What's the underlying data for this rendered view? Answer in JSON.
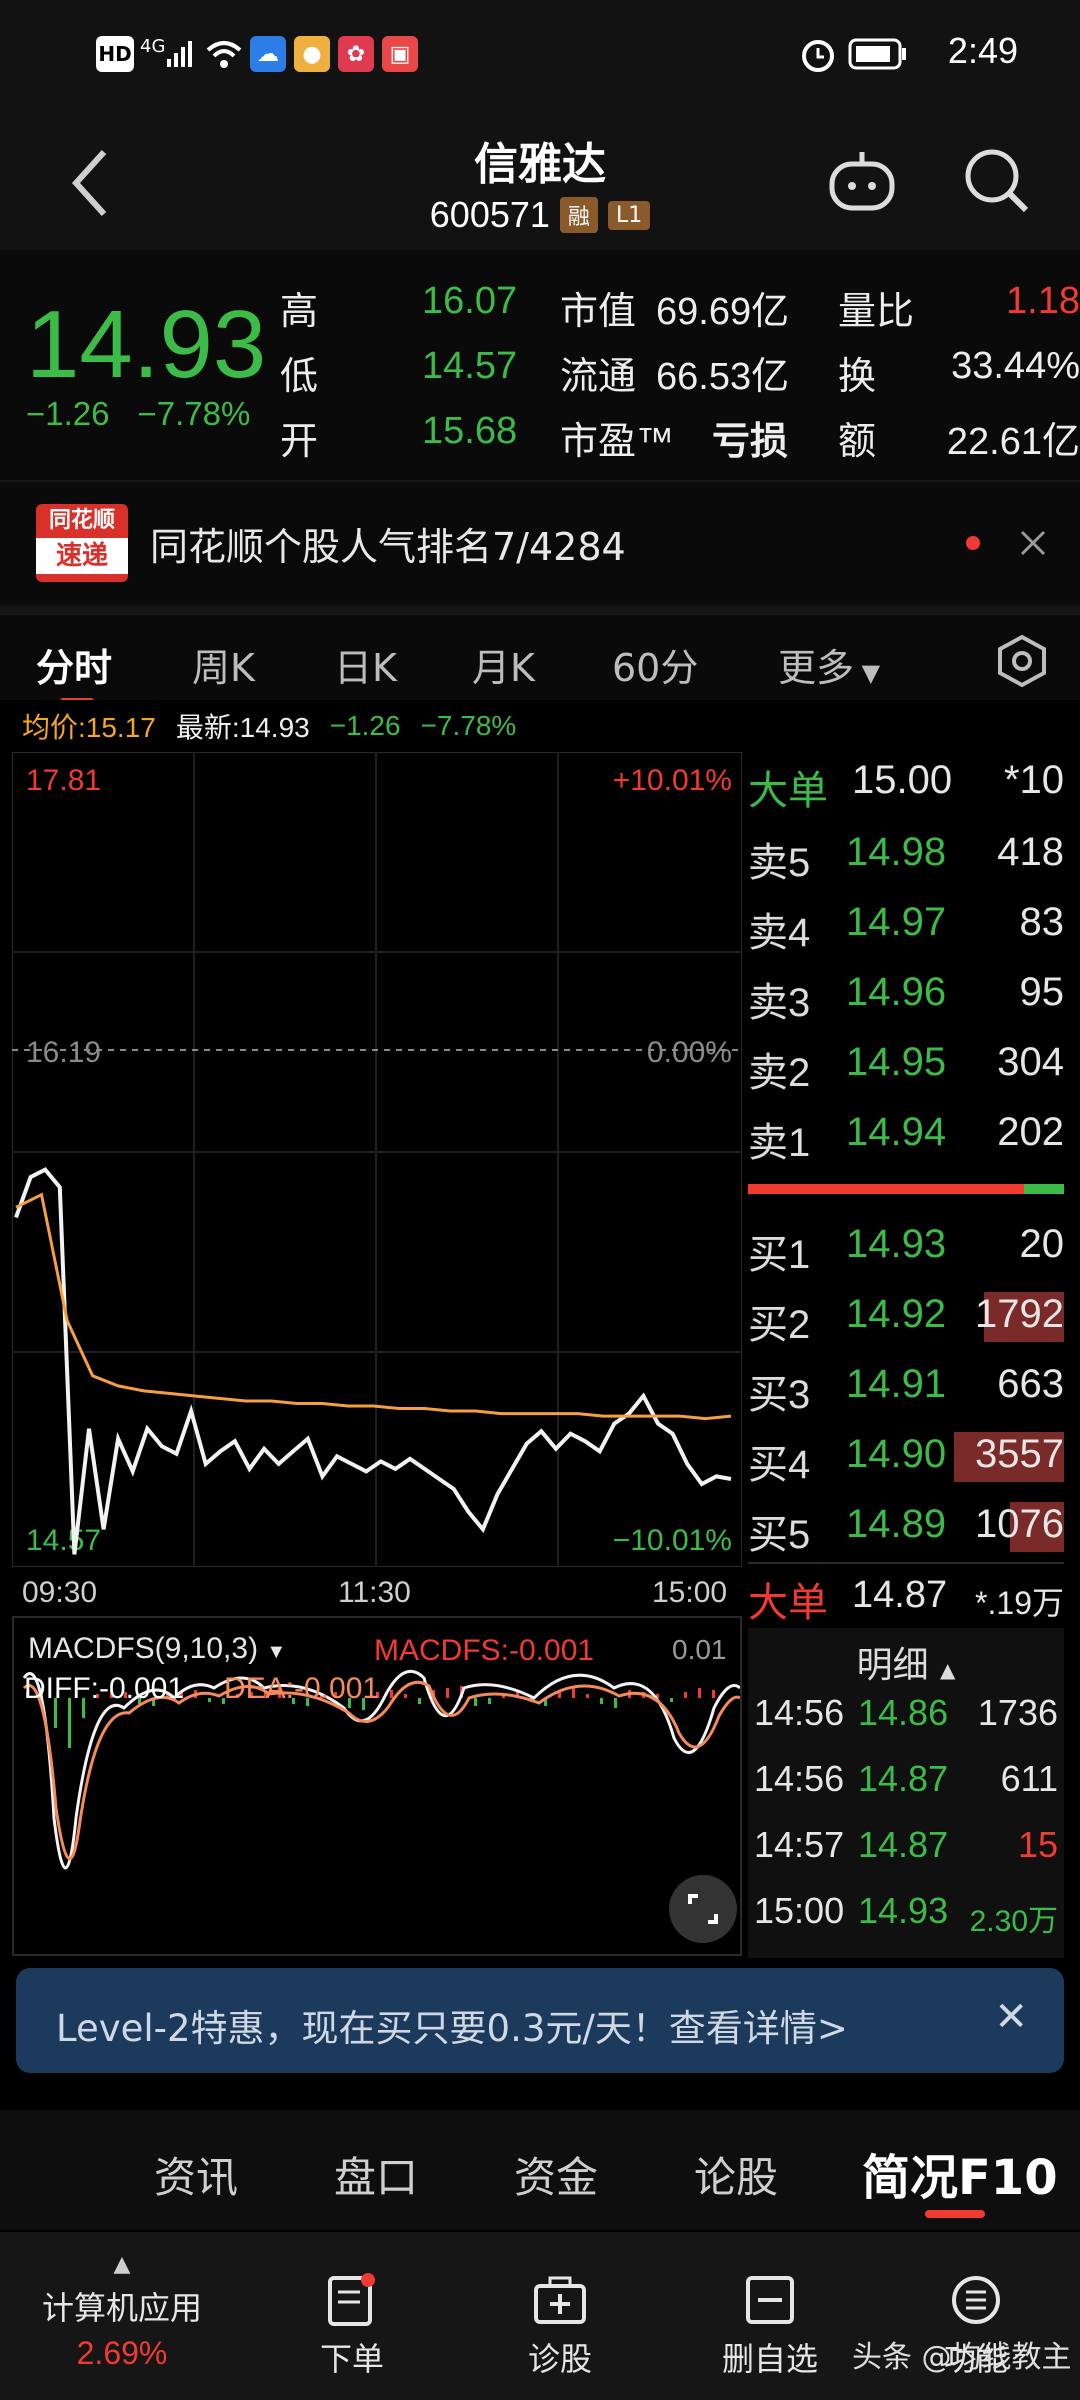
{
  "status_bar": {
    "hd": "HD",
    "net": "4G",
    "time": "2:49",
    "icons": [
      "signal-icon",
      "wifi-icon",
      "cloud-app-icon",
      "app-icon",
      "app-icon",
      "app-icon",
      "alarm-icon",
      "battery-icon"
    ]
  },
  "header": {
    "title": "信雅达",
    "code": "600571",
    "tag_margin": "融",
    "tag_level": "L1"
  },
  "quote": {
    "price": "14.93",
    "change": "−1.26",
    "change_pct": "−7.78%",
    "high_label": "高",
    "high": "16.07",
    "low_label": "低",
    "low": "14.57",
    "open_label": "开",
    "open": "15.68",
    "mcap_label": "市值",
    "mcap": "69.69亿",
    "float_label": "流通",
    "float": "66.53亿",
    "pe_label": "市盈™",
    "pe": "亏损",
    "vr_label": "量比",
    "vr": "1.18",
    "turn_label": "换",
    "turn": "33.44%",
    "amt_label": "额",
    "amt": "22.61亿"
  },
  "news": {
    "logo_top": "同花顺",
    "logo_bottom": "速递",
    "text": "同花顺个股人气排名7/4284"
  },
  "tabs": [
    "分时",
    "周K",
    "日K",
    "月K",
    "60分",
    "更多"
  ],
  "infoline": {
    "avg": "均价:15.17",
    "latest": "最新:14.93",
    "chg": "−1.26",
    "pct": "−7.78%"
  },
  "chart_data": {
    "type": "line",
    "y_max_label": "17.81",
    "y_mid_label": "16.19",
    "y_min_label": "14.57",
    "pct_max_label": "+10.01%",
    "pct_mid_label": "0.00%",
    "pct_min_label": "−10.01%",
    "x_labels": [
      "09:30",
      "11:30",
      "15:00"
    ],
    "ylim": [
      14.57,
      17.81
    ],
    "prev_close": 16.19,
    "series": [
      {
        "name": "price",
        "values": [
          15.96,
          16.12,
          16.15,
          16.08,
          14.62,
          15.12,
          14.72,
          15.08,
          14.95,
          15.12,
          15.05,
          15.02,
          15.19,
          14.98,
          15.03,
          15.07,
          14.96,
          15.04,
          14.98,
          15.03,
          15.08,
          14.93,
          15.01,
          14.98,
          14.95,
          14.99,
          14.96,
          15.0,
          14.96,
          14.92,
          14.88,
          14.79,
          14.72,
          14.86,
          14.96,
          15.06,
          15.11,
          15.04,
          15.1,
          15.07,
          15.03,
          15.14,
          15.18,
          15.25,
          15.14,
          15.1,
          14.98,
          14.9,
          14.93,
          14.92
        ]
      },
      {
        "name": "avg",
        "values": [
          16.0,
          16.05,
          15.55,
          15.33,
          15.29,
          15.27,
          15.26,
          15.25,
          15.24,
          15.23,
          15.23,
          15.22,
          15.22,
          15.21,
          15.21,
          15.2,
          15.2,
          15.19,
          15.19,
          15.18,
          15.18,
          15.18,
          15.18,
          15.17,
          15.17,
          15.17,
          15.17,
          15.16,
          15.17
        ]
      }
    ]
  },
  "macd": {
    "title": "MACDFS(9,10,3)",
    "macd_label": "MACDFS:-0.001",
    "diff_label": "DIFF:-0.001",
    "dea_label": "DEA:-0.001",
    "right_val": "0.01"
  },
  "book": {
    "big_sell": {
      "label": "大单",
      "price": "15.00",
      "vol": "*10"
    },
    "sells": [
      {
        "label": "卖5",
        "price": "14.98",
        "vol": "418"
      },
      {
        "label": "卖4",
        "price": "14.97",
        "vol": "83"
      },
      {
        "label": "卖3",
        "price": "14.96",
        "vol": "95"
      },
      {
        "label": "卖2",
        "price": "14.95",
        "vol": "304"
      },
      {
        "label": "卖1",
        "price": "14.94",
        "vol": "202"
      }
    ],
    "buys": [
      {
        "label": "买1",
        "price": "14.93",
        "vol": "20"
      },
      {
        "label": "买2",
        "price": "14.92",
        "vol": "1792"
      },
      {
        "label": "买3",
        "price": "14.91",
        "vol": "663"
      },
      {
        "label": "买4",
        "price": "14.90",
        "vol": "3557"
      },
      {
        "label": "买5",
        "price": "14.89",
        "vol": "1076"
      }
    ],
    "big_buy": {
      "label": "大单",
      "price": "14.87",
      "vol": "*.19万"
    },
    "detail_title": "明细",
    "ticks": [
      {
        "time": "14:56",
        "price": "14.86",
        "vol": "1736"
      },
      {
        "time": "14:56",
        "price": "14.87",
        "vol": "611"
      },
      {
        "time": "14:57",
        "price": "14.87",
        "vol": "15"
      },
      {
        "time": "15:00",
        "price": "14.93",
        "vol": "2.30万"
      }
    ]
  },
  "promo": {
    "text": "Level-2特惠，现在买只要0.3元/天！查看详情>",
    "close": "✕"
  },
  "lower_tabs": [
    "资讯",
    "盘口",
    "资金",
    "论股",
    "简况F10"
  ],
  "bottom_bar": {
    "sector_name": "计算机应用",
    "sector_pct": "2.69%",
    "order": "下单",
    "diagnose": "诊股",
    "remove_fav": "删自选",
    "more": "功能",
    "watermark": "头条 @均线教主"
  }
}
